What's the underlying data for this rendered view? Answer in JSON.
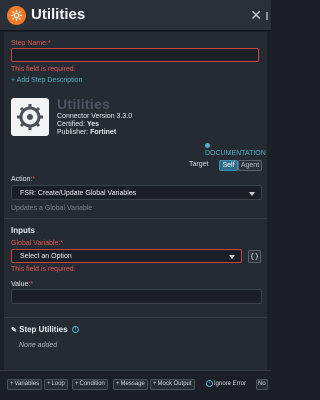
{
  "header": {
    "title": "Utilities",
    "close": "✕"
  },
  "step_name": {
    "label": "Step Name:",
    "required": "*",
    "value": "",
    "error": "This field is required."
  },
  "add_description": "+ Add Step Description",
  "connector": {
    "name": "Utilities",
    "version": "Connector Version 3.3.0",
    "certified_label": "Certified:",
    "certified_value": "Yes",
    "publisher_label": "Publisher:",
    "publisher_value": "Fortinet"
  },
  "documentation": "DOCUMENTATION",
  "target": {
    "label": "Target",
    "options": [
      "Self",
      "Agent"
    ],
    "selected": "Self"
  },
  "action": {
    "label": "Action:",
    "required": "*",
    "value": "FSR: Create/Update Global Variables",
    "description": "Updates a Global Variable"
  },
  "inputs": {
    "title": "Inputs",
    "global_variable": {
      "label": "Global Variable:",
      "required": "*",
      "placeholder": "Select an Option",
      "error": "This field is required."
    },
    "value": {
      "label": "Value:",
      "required": "*",
      "value": ""
    }
  },
  "step_utilities": {
    "title": "Step Utilities",
    "empty": "None added"
  },
  "footer": {
    "buttons": [
      "Variables",
      "Loop",
      "Condition",
      "Message",
      "Mock Output"
    ],
    "ignore_error": "Ignore Error",
    "toggle": "No"
  },
  "colors": {
    "accent": "#ee7a2a",
    "error": "#e35555",
    "link": "#4fb0c4"
  }
}
